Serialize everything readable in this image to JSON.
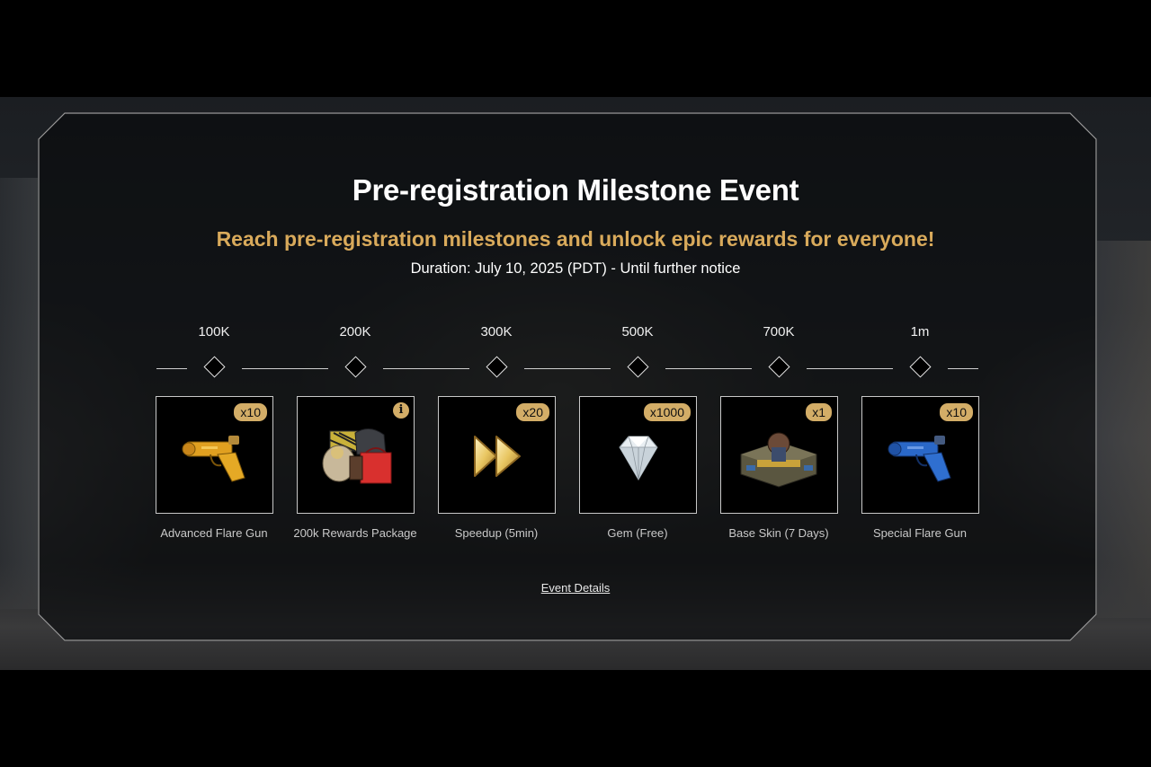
{
  "header": {
    "title": "Pre-registration Milestone Event",
    "subtitle": "Reach pre-registration milestones and unlock epic rewards for everyone!",
    "duration": "Duration: July 10, 2025 (PDT) - Until further notice"
  },
  "milestones": [
    {
      "label": "100K",
      "reward": "Advanced Flare Gun",
      "quantity": "x10",
      "icon": "yellow-flare-gun-icon"
    },
    {
      "label": "200K",
      "reward": "200k Rewards Package",
      "quantity": "",
      "info": "i",
      "icon": "rewards-package-icon"
    },
    {
      "label": "300K",
      "reward": "Speedup (5min)",
      "quantity": "x20",
      "icon": "speedup-icon"
    },
    {
      "label": "500K",
      "reward": "Gem (Free)",
      "quantity": "x1000",
      "icon": "gem-icon"
    },
    {
      "label": "700K",
      "reward": "Base Skin (7 Days)",
      "quantity": "x1",
      "icon": "base-skin-icon"
    },
    {
      "label": "1m",
      "reward": "Special Flare Gun",
      "quantity": "x10",
      "icon": "blue-flare-gun-icon"
    }
  ],
  "footer": {
    "event_details_label": "Event Details"
  },
  "colors": {
    "accent_gold": "#d9aa5b",
    "badge_gold": "#d3ad67",
    "panel_bg": "#06080a"
  }
}
